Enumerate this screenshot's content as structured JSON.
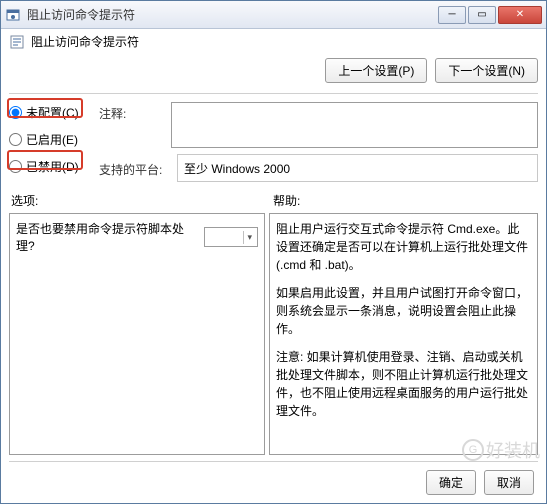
{
  "window": {
    "title": "阻止访问命令提示符"
  },
  "titlebar_controls": {
    "min": "─",
    "max": "▭",
    "close": "✕"
  },
  "header": {
    "title": "阻止访问命令提示符"
  },
  "nav": {
    "prev": "上一个设置(P)",
    "next": "下一个设置(N)"
  },
  "radios": {
    "not_configured": "未配置(C)",
    "enabled": "已启用(E)",
    "disabled": "已禁用(D)"
  },
  "labels": {
    "comment": "注释:",
    "supported_platform": "支持的平台:",
    "options": "选项:",
    "help": "帮助:"
  },
  "values": {
    "comment": "",
    "supported_platform": "至少 Windows 2000"
  },
  "options_panel": {
    "row1_label": "是否也要禁用命令提示符脚本处理?",
    "dropdown_selected": ""
  },
  "help_panel": {
    "p1": "阻止用户运行交互式命令提示符 Cmd.exe。此设置还确定是否可以在计算机上运行批处理文件(.cmd 和 .bat)。",
    "p2": "如果启用此设置，并且用户试图打开命令窗口，则系统会显示一条消息，说明设置会阻止此操作。",
    "p3": "注意: 如果计算机使用登录、注销、启动或关机批处理文件脚本，则不阻止计算机运行批处理文件，也不阻止使用远程桌面服务的用户运行批处理文件。"
  },
  "footer": {
    "ok": "确定",
    "cancel": "取消"
  }
}
